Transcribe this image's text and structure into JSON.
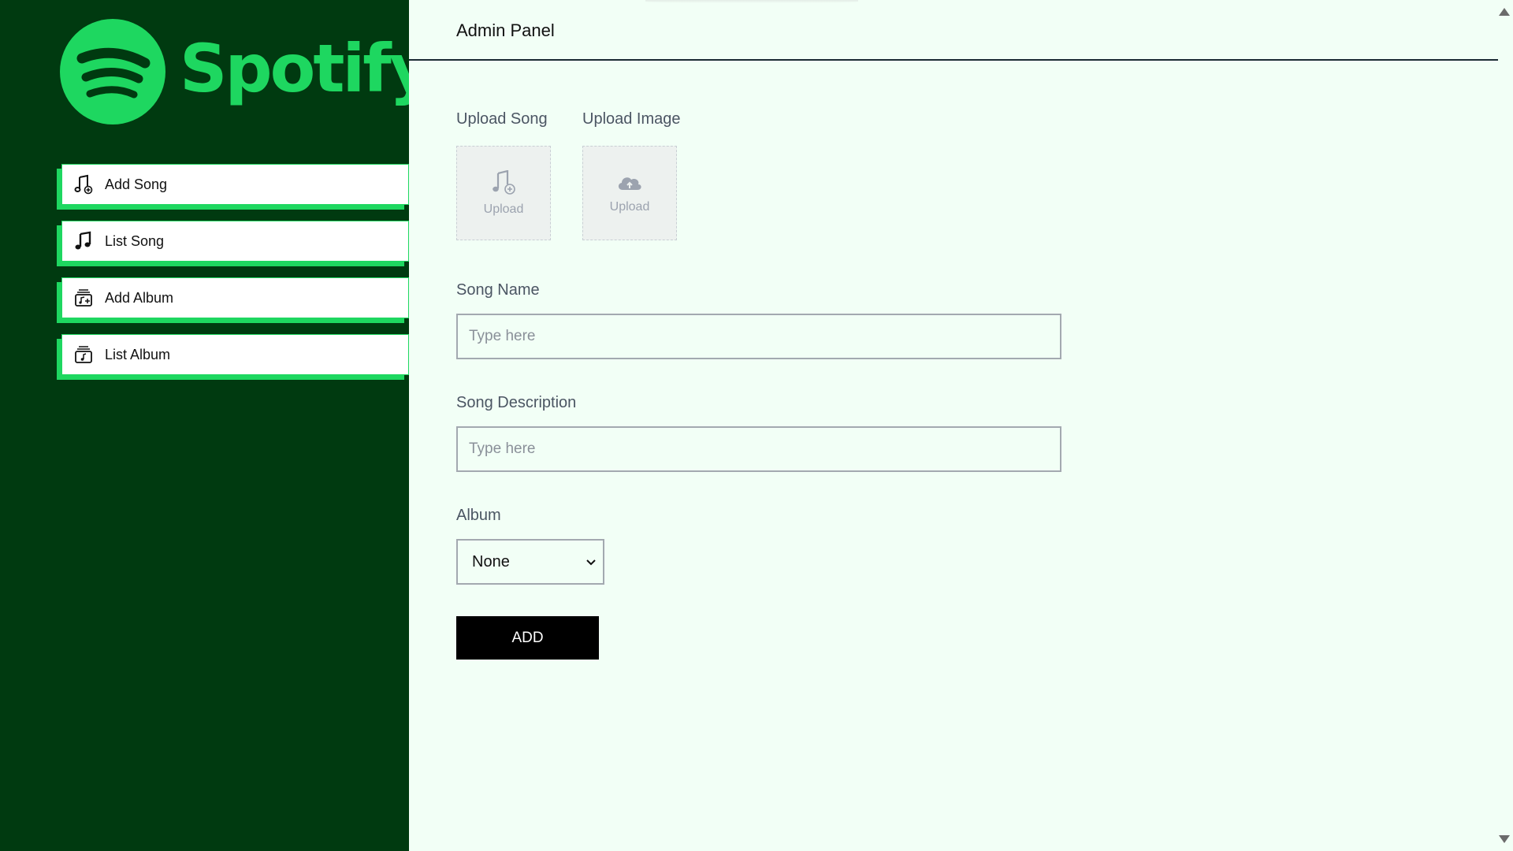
{
  "brand": {
    "name": "Spotify",
    "registered_mark": "®",
    "color": "#1ed760"
  },
  "sidebar": {
    "background": "#003a10",
    "items": [
      {
        "label": "Add Song",
        "icon": "add-song-icon"
      },
      {
        "label": "List Song",
        "icon": "music-note-icon"
      },
      {
        "label": "Add Album",
        "icon": "add-album-icon"
      },
      {
        "label": "List Album",
        "icon": "album-icon"
      }
    ]
  },
  "header": {
    "title": "Admin Panel"
  },
  "form": {
    "upload_song": {
      "label": "Upload Song",
      "button_text": "Upload",
      "icon": "music-add-icon"
    },
    "upload_image": {
      "label": "Upload Image",
      "button_text": "Upload",
      "icon": "cloud-upload-icon"
    },
    "song_name": {
      "label": "Song Name",
      "value": "",
      "placeholder": "Type here"
    },
    "song_description": {
      "label": "Song Description",
      "value": "",
      "placeholder": "Type here"
    },
    "album": {
      "label": "Album",
      "selected": "None"
    },
    "submit_label": "ADD"
  }
}
